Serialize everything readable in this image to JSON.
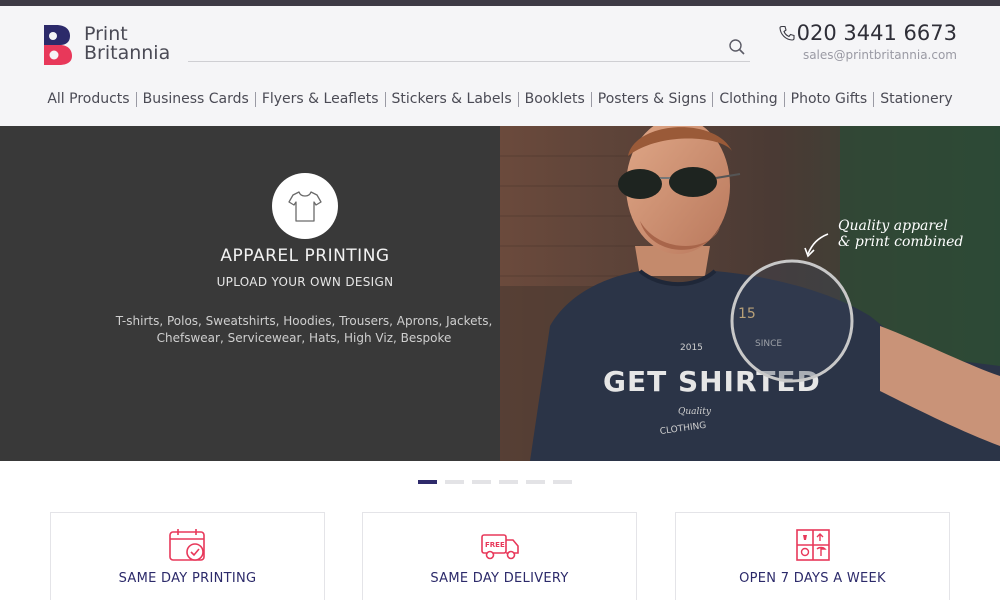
{
  "brand": {
    "line1": "Print",
    "line2": "Britannia"
  },
  "search": {
    "placeholder": ""
  },
  "contact": {
    "phone": "020 3441 6673",
    "email": "sales@printbritannia.com"
  },
  "nav": {
    "items": [
      "All Products",
      "Business Cards",
      "Flyers & Leaflets",
      "Stickers & Labels",
      "Booklets",
      "Posters & Signs",
      "Clothing",
      "Photo Gifts",
      "Stationery"
    ]
  },
  "hero": {
    "title": "APPAREL PRINTING",
    "subtitle": "UPLOAD YOUR OWN DESIGN",
    "description_line1": "T-shirts, Polos, Sweatshirts, Hoodies, Trousers, Aprons, Jackets,",
    "description_line2": "Chefswear, Servicewear, Hats, High Viz, Bespoke",
    "photo": {
      "callout_line1": "Quality apparel",
      "callout_line2": "& print combined",
      "shirt_text": "GET SHIRTED",
      "shirt_since": "SINCE",
      "shirt_year": "2015",
      "shirt_clothing": "CLOTHING",
      "shirt_quality": "Quality",
      "zoom_number": "15"
    }
  },
  "carousel": {
    "slide_count": 6,
    "active_index": 0
  },
  "features": [
    {
      "title": "SAME DAY PRINTING",
      "icon": "calendar-check-icon"
    },
    {
      "title": "SAME DAY DELIVERY",
      "icon": "delivery-truck-icon",
      "badge": "FREE"
    },
    {
      "title": "OPEN 7 DAYS A WEEK",
      "icon": "package-box-icon"
    }
  ],
  "colors": {
    "accent": "#2e2a6b",
    "brand_red": "#e8385a",
    "brand_navy": "#2c2a6a",
    "hero_bg": "#393939",
    "header_bg": "#f5f5f7"
  }
}
